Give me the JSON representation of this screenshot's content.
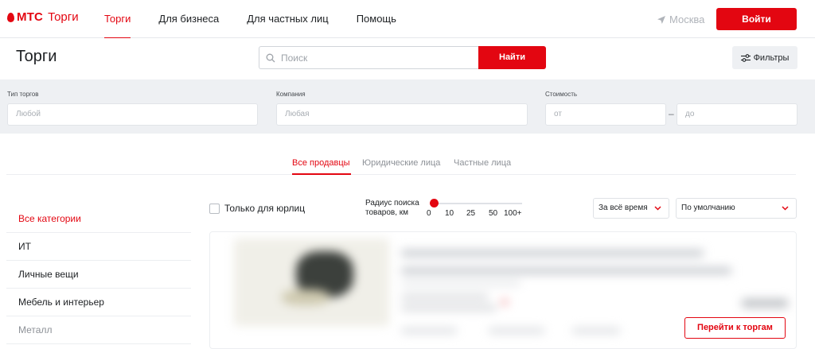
{
  "header": {
    "logo_brand": "МТС",
    "logo_product": "Торги",
    "nav": [
      "Торги",
      "Для бизнеса",
      "Для частных лиц",
      "Помощь"
    ],
    "city": "Москва",
    "login_label": "Войти"
  },
  "page": {
    "title": "Торги",
    "search_placeholder": "Поиск",
    "search_button": "Найти",
    "filters_button": "Фильтры"
  },
  "filters": {
    "type_label": "Тип торгов",
    "type_value": "Любой",
    "company_label": "Компания",
    "company_value": "Любая",
    "price_label": "Стоимость",
    "price_from": "от",
    "price_to": "до",
    "dash": "–"
  },
  "tabs": [
    "Все продавцы",
    "Юридические лица",
    "Частные лица"
  ],
  "categories": [
    "Все категории",
    "ИТ",
    "Личные вещи",
    "Мебель и интерьер",
    "Металл"
  ],
  "controls": {
    "only_legal": "Только для юрлиц",
    "radius_label_1": "Радиус поиска",
    "radius_label_2": "товаров, км",
    "radius_ticks": [
      "0",
      "10",
      "25",
      "50",
      "100+"
    ],
    "radius_value": "0",
    "period_select": "За всё время",
    "sort_select": "По умолчанию"
  },
  "card": {
    "goto_button": "Перейти к торгам"
  },
  "colors": {
    "accent": "#e30611",
    "panel_bg": "#eef0f3"
  }
}
